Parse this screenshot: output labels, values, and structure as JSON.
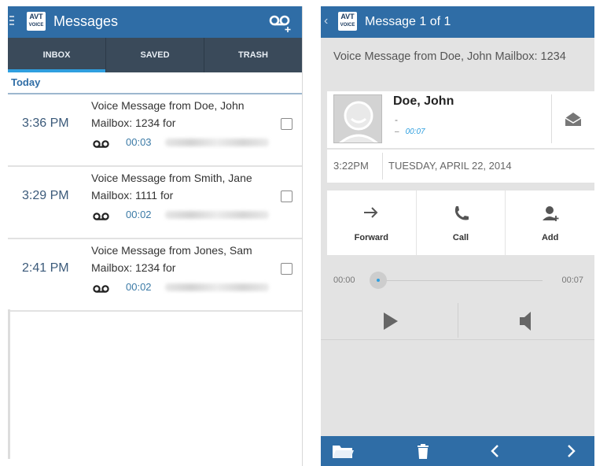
{
  "left": {
    "app_title": "Messages",
    "logo_text": "AVT",
    "logo_sub": "VOICE",
    "tabs": [
      {
        "label": "INBOX",
        "active": true
      },
      {
        "label": "SAVED",
        "active": false
      },
      {
        "label": "TRASH",
        "active": false
      }
    ],
    "section": "Today",
    "messages": [
      {
        "time": "3:36 PM",
        "line1": "Voice Message from Doe, John",
        "line2": "Mailbox: 1234 for",
        "duration": "00:03"
      },
      {
        "time": "3:29 PM",
        "line1": "Voice Message from Smith, Jane",
        "line2": "Mailbox: 1111 for",
        "duration": "00:02"
      },
      {
        "time": "2:41 PM",
        "line1": "Voice Message from Jones, Sam",
        "line2": "Mailbox: 1234 for",
        "duration": "00:02"
      }
    ]
  },
  "right": {
    "title": "Message 1 of 1",
    "back_glyph": "‹",
    "subject": "Voice Message from Doe, John Mailbox: 1234",
    "contact_name": "Doe, John",
    "contact_dash": "-",
    "contact_dur_dash": "–",
    "contact_duration": "00:07",
    "date_time": "3:22PM",
    "date": "TUESDAY, APRIL 22, 2014",
    "actions": [
      {
        "label": "Forward",
        "icon": "forward-arrow-icon"
      },
      {
        "label": "Call",
        "icon": "phone-icon"
      },
      {
        "label": "Add",
        "icon": "add-contact-icon"
      }
    ],
    "position_start": "00:00",
    "position_end": "00:07",
    "playback_fraction": 0.0
  },
  "colors": {
    "bar_blue": "#2f6da6",
    "tab_dark": "#3a4a5a",
    "accent_cyan": "#2f9fdf",
    "panel_gray": "#e3e3e3"
  }
}
